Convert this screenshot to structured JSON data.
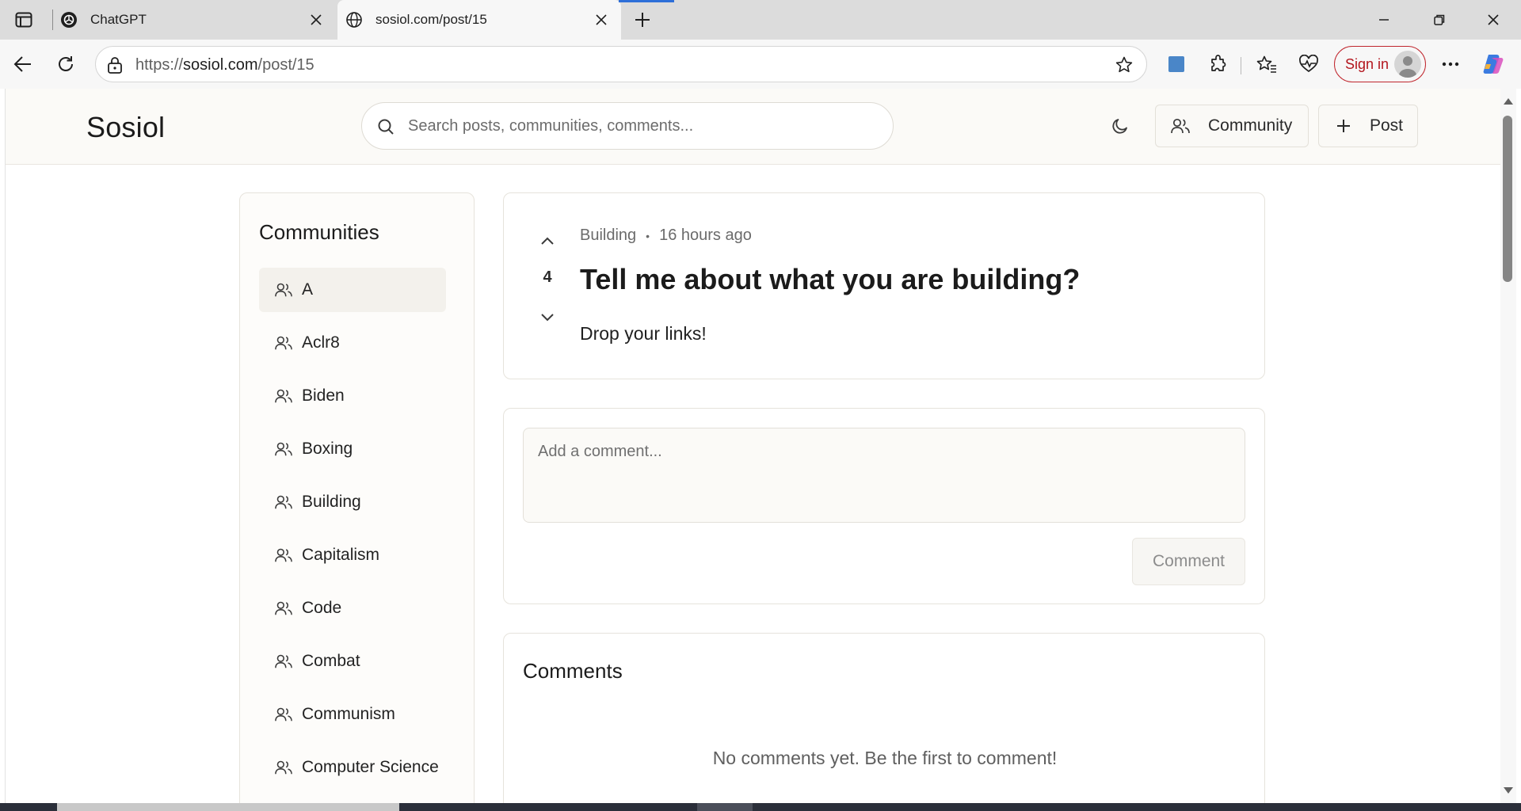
{
  "browser": {
    "tabs": [
      {
        "title": "ChatGPT",
        "icon": "chatgpt-logo-icon"
      },
      {
        "title": "sosiol.com/post/15",
        "icon": "globe-icon",
        "active": true
      }
    ],
    "url_prefix": "https://",
    "url_domain": "sosiol.com",
    "url_path": "/post/15",
    "signin_label": "Sign in"
  },
  "site": {
    "logo": "Sosiol",
    "search_placeholder": "Search posts, communities, comments...",
    "community_button": "Community",
    "post_button": "Post"
  },
  "sidebar": {
    "title": "Communities",
    "items": [
      {
        "label": "A",
        "active": true
      },
      {
        "label": "Aclr8"
      },
      {
        "label": "Biden"
      },
      {
        "label": "Boxing"
      },
      {
        "label": "Building"
      },
      {
        "label": "Capitalism"
      },
      {
        "label": "Code"
      },
      {
        "label": "Combat"
      },
      {
        "label": "Communism"
      },
      {
        "label": "Computer Science"
      }
    ]
  },
  "post": {
    "community": "Building",
    "separator": "•",
    "time": "16 hours ago",
    "votes": "4",
    "title": "Tell me about what you are building?",
    "body": "Drop your links!"
  },
  "comment_form": {
    "placeholder": "Add a comment...",
    "submit_label": "Comment"
  },
  "comments": {
    "title": "Comments",
    "empty_text": "No comments yet. Be the first to comment!"
  },
  "colors": {
    "accent_signin": "#b3151d",
    "header_bg": "#fbfaf7",
    "border": "#e6e3dc"
  }
}
